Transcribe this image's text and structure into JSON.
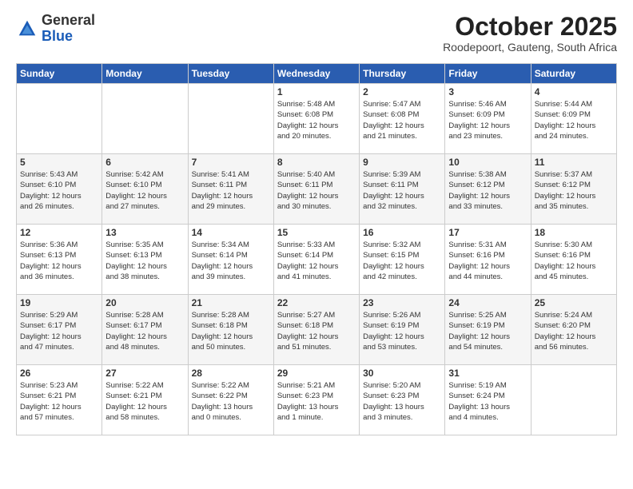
{
  "header": {
    "logo": {
      "general": "General",
      "blue": "Blue"
    },
    "title": "October 2025",
    "location": "Roodepoort, Gauteng, South Africa"
  },
  "weekdays": [
    "Sunday",
    "Monday",
    "Tuesday",
    "Wednesday",
    "Thursday",
    "Friday",
    "Saturday"
  ],
  "weeks": [
    [
      {
        "day": "",
        "info": ""
      },
      {
        "day": "",
        "info": ""
      },
      {
        "day": "",
        "info": ""
      },
      {
        "day": "1",
        "info": "Sunrise: 5:48 AM\nSunset: 6:08 PM\nDaylight: 12 hours\nand 20 minutes."
      },
      {
        "day": "2",
        "info": "Sunrise: 5:47 AM\nSunset: 6:08 PM\nDaylight: 12 hours\nand 21 minutes."
      },
      {
        "day": "3",
        "info": "Sunrise: 5:46 AM\nSunset: 6:09 PM\nDaylight: 12 hours\nand 23 minutes."
      },
      {
        "day": "4",
        "info": "Sunrise: 5:44 AM\nSunset: 6:09 PM\nDaylight: 12 hours\nand 24 minutes."
      }
    ],
    [
      {
        "day": "5",
        "info": "Sunrise: 5:43 AM\nSunset: 6:10 PM\nDaylight: 12 hours\nand 26 minutes."
      },
      {
        "day": "6",
        "info": "Sunrise: 5:42 AM\nSunset: 6:10 PM\nDaylight: 12 hours\nand 27 minutes."
      },
      {
        "day": "7",
        "info": "Sunrise: 5:41 AM\nSunset: 6:11 PM\nDaylight: 12 hours\nand 29 minutes."
      },
      {
        "day": "8",
        "info": "Sunrise: 5:40 AM\nSunset: 6:11 PM\nDaylight: 12 hours\nand 30 minutes."
      },
      {
        "day": "9",
        "info": "Sunrise: 5:39 AM\nSunset: 6:11 PM\nDaylight: 12 hours\nand 32 minutes."
      },
      {
        "day": "10",
        "info": "Sunrise: 5:38 AM\nSunset: 6:12 PM\nDaylight: 12 hours\nand 33 minutes."
      },
      {
        "day": "11",
        "info": "Sunrise: 5:37 AM\nSunset: 6:12 PM\nDaylight: 12 hours\nand 35 minutes."
      }
    ],
    [
      {
        "day": "12",
        "info": "Sunrise: 5:36 AM\nSunset: 6:13 PM\nDaylight: 12 hours\nand 36 minutes."
      },
      {
        "day": "13",
        "info": "Sunrise: 5:35 AM\nSunset: 6:13 PM\nDaylight: 12 hours\nand 38 minutes."
      },
      {
        "day": "14",
        "info": "Sunrise: 5:34 AM\nSunset: 6:14 PM\nDaylight: 12 hours\nand 39 minutes."
      },
      {
        "day": "15",
        "info": "Sunrise: 5:33 AM\nSunset: 6:14 PM\nDaylight: 12 hours\nand 41 minutes."
      },
      {
        "day": "16",
        "info": "Sunrise: 5:32 AM\nSunset: 6:15 PM\nDaylight: 12 hours\nand 42 minutes."
      },
      {
        "day": "17",
        "info": "Sunrise: 5:31 AM\nSunset: 6:16 PM\nDaylight: 12 hours\nand 44 minutes."
      },
      {
        "day": "18",
        "info": "Sunrise: 5:30 AM\nSunset: 6:16 PM\nDaylight: 12 hours\nand 45 minutes."
      }
    ],
    [
      {
        "day": "19",
        "info": "Sunrise: 5:29 AM\nSunset: 6:17 PM\nDaylight: 12 hours\nand 47 minutes."
      },
      {
        "day": "20",
        "info": "Sunrise: 5:28 AM\nSunset: 6:17 PM\nDaylight: 12 hours\nand 48 minutes."
      },
      {
        "day": "21",
        "info": "Sunrise: 5:28 AM\nSunset: 6:18 PM\nDaylight: 12 hours\nand 50 minutes."
      },
      {
        "day": "22",
        "info": "Sunrise: 5:27 AM\nSunset: 6:18 PM\nDaylight: 12 hours\nand 51 minutes."
      },
      {
        "day": "23",
        "info": "Sunrise: 5:26 AM\nSunset: 6:19 PM\nDaylight: 12 hours\nand 53 minutes."
      },
      {
        "day": "24",
        "info": "Sunrise: 5:25 AM\nSunset: 6:19 PM\nDaylight: 12 hours\nand 54 minutes."
      },
      {
        "day": "25",
        "info": "Sunrise: 5:24 AM\nSunset: 6:20 PM\nDaylight: 12 hours\nand 56 minutes."
      }
    ],
    [
      {
        "day": "26",
        "info": "Sunrise: 5:23 AM\nSunset: 6:21 PM\nDaylight: 12 hours\nand 57 minutes."
      },
      {
        "day": "27",
        "info": "Sunrise: 5:22 AM\nSunset: 6:21 PM\nDaylight: 12 hours\nand 58 minutes."
      },
      {
        "day": "28",
        "info": "Sunrise: 5:22 AM\nSunset: 6:22 PM\nDaylight: 13 hours\nand 0 minutes."
      },
      {
        "day": "29",
        "info": "Sunrise: 5:21 AM\nSunset: 6:23 PM\nDaylight: 13 hours\nand 1 minute."
      },
      {
        "day": "30",
        "info": "Sunrise: 5:20 AM\nSunset: 6:23 PM\nDaylight: 13 hours\nand 3 minutes."
      },
      {
        "day": "31",
        "info": "Sunrise: 5:19 AM\nSunset: 6:24 PM\nDaylight: 13 hours\nand 4 minutes."
      },
      {
        "day": "",
        "info": ""
      }
    ]
  ]
}
